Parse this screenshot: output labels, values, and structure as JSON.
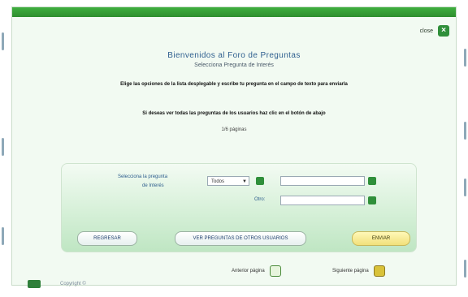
{
  "header": {
    "close_label": "close",
    "title": "Bienvenidos al Foro de Preguntas",
    "subtitle": "Selecciona Pregunta de Interés"
  },
  "instructions": {
    "line1": "Elige las opciones de la lista desplegable y escribe tu pregunta en el campo de texto para enviarla",
    "line2": "Si deseas ver todas las preguntas de los usuarios haz clic en el botón de abajo",
    "page": "1/6 páginas"
  },
  "form": {
    "label_category_a": "Selecciona la pregunta",
    "label_category_b": "de Interés",
    "select_value": "Todos",
    "label_field2": "Otro:",
    "field1_value": "",
    "field2_value": ""
  },
  "buttons": {
    "left": "REGRESAR",
    "middle": "VER PREGUNTAS DE OTROS USUARIOS",
    "right": "ENVIAR"
  },
  "nav": {
    "prev_label": "Anterior página",
    "next_label": "Siguiente página"
  },
  "footer": {
    "text": "Copyright ©"
  },
  "colors": {
    "topbar": "#2e8e2e",
    "panel_bottom": "#bfe6c3",
    "accent_button": "#f1e07a"
  }
}
